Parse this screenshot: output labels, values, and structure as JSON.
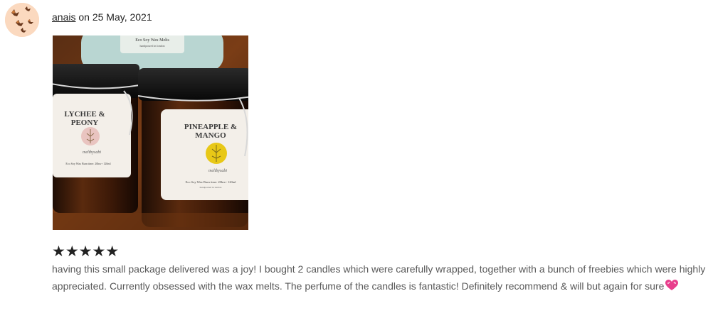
{
  "review": {
    "author": "anais",
    "date_prefix": " on ",
    "date": "25 May, 2021",
    "rating": 5,
    "stars_display": "★★★★★",
    "text": "having this small package delivered was a joy! I bought 2 candles which were carefully wrapped, together with a bunch of freebies which were highly appreciated. Currently obsessed with the wax melts. The perfume of the candles is fantastic! Definitely recommend & will but again for sure",
    "emoji_icon": "sparkling-heart-icon"
  },
  "photo": {
    "top_label_line1": "Eco Soy Wax Melts",
    "top_label_line2": "handpoured in london",
    "left_candle_name_line1": "LYCHEE &",
    "left_candle_name_line2": "PEONY",
    "right_candle_name_line1": "PINEAPPLE &",
    "right_candle_name_line2": "MANGO",
    "brand": "meltbysabi",
    "label_footer": "Eco Soy Wax   Burn time: 20hrs+   120ml",
    "label_sub": "handpoured in london"
  },
  "colors": {
    "avatar_bg": "#fbd9bf",
    "text": "#222222",
    "review_text": "#595959"
  }
}
